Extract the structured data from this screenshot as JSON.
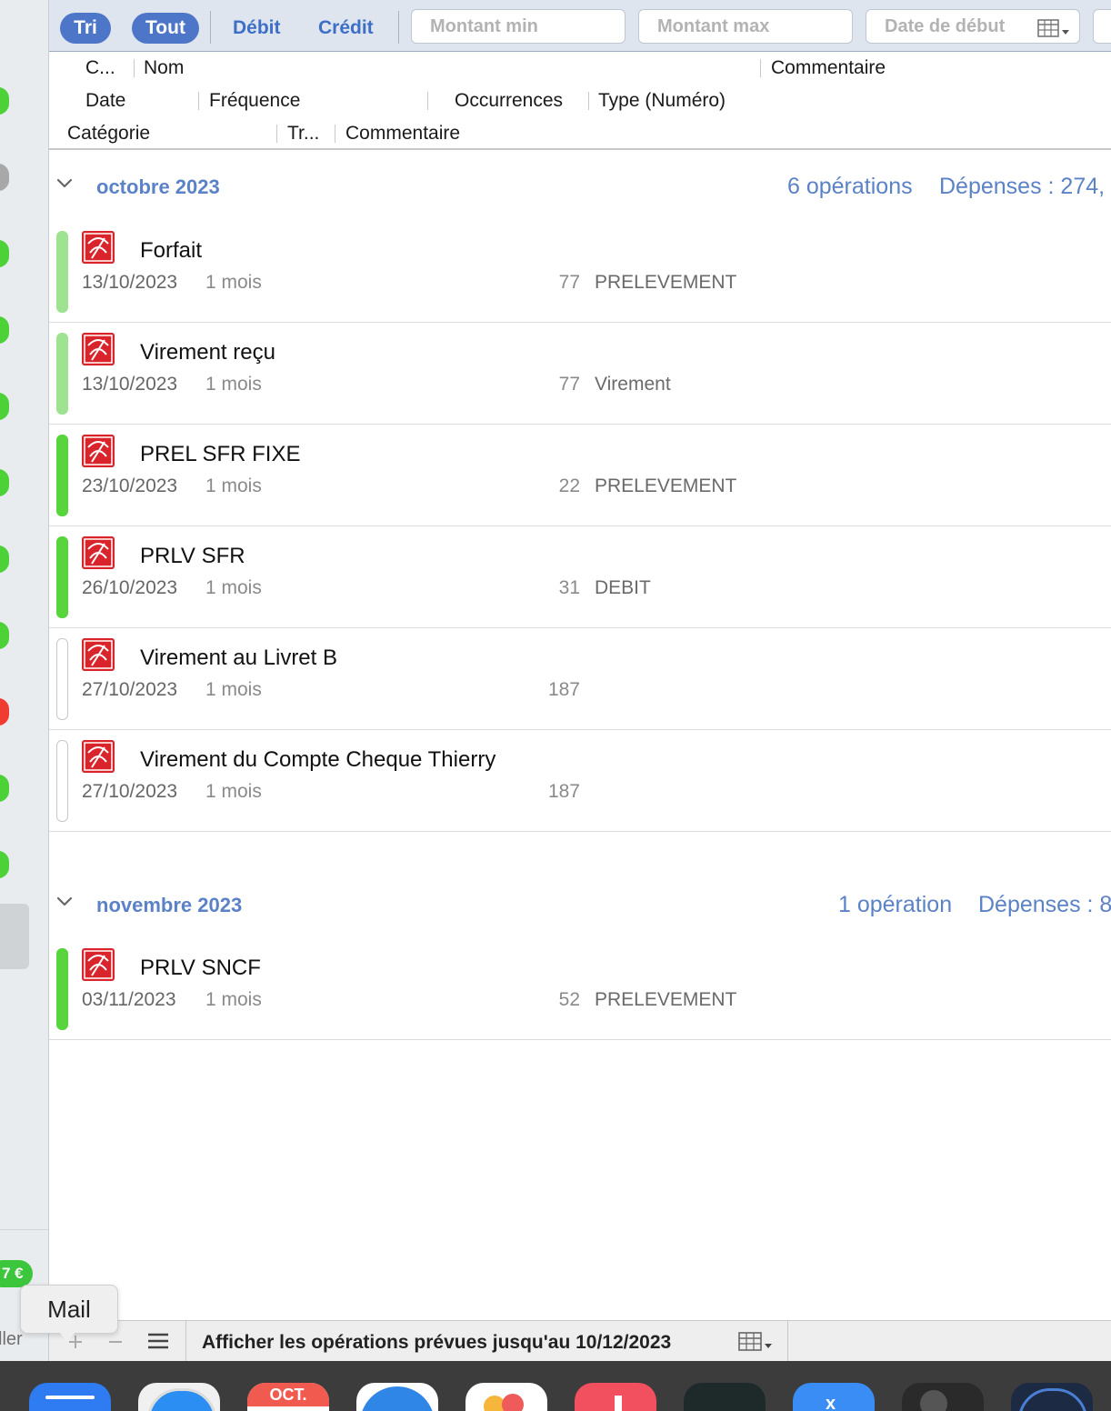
{
  "toolbar": {
    "sort_label": "Tri",
    "all_label": "Tout",
    "debit_label": "Débit",
    "credit_label": "Crédit",
    "amount_min_placeholder": "Montant min",
    "amount_max_placeholder": "Montant max",
    "start_date_placeholder": "Date de début",
    "calendar_icon": "calendar-grid-icon"
  },
  "columns": {
    "c": "C...",
    "nom": "Nom",
    "commentaire_top": "Commentaire",
    "date": "Date",
    "frequence": "Fréquence",
    "occurrences": "Occurrences",
    "type_numero": "Type (Numéro)",
    "categorie": "Catégorie",
    "tr": "Tr...",
    "commentaire_bottom": "Commentaire"
  },
  "groups": [
    {
      "month": "octobre 2023",
      "count": "6 opérations",
      "expenses": "Dépenses : 274,",
      "rows": [
        {
          "name": "Forfait",
          "date": "13/10/2023",
          "frequency": "1 mois",
          "occurrences": "77",
          "type": "PRELEVEMENT",
          "status": "lightgreen"
        },
        {
          "name": "Virement reçu",
          "date": "13/10/2023",
          "frequency": "1 mois",
          "occurrences": "77",
          "type": "Virement",
          "status": "lightgreen"
        },
        {
          "name": "PREL SFR FIXE",
          "date": "23/10/2023",
          "frequency": "1 mois",
          "occurrences": "22",
          "type": "PRELEVEMENT",
          "status": "green"
        },
        {
          "name": "PRLV SFR",
          "date": "26/10/2023",
          "frequency": "1 mois",
          "occurrences": "31",
          "type": "DEBIT",
          "status": "green"
        },
        {
          "name": "Virement au Livret B",
          "date": "27/10/2023",
          "frequency": "1 mois",
          "occurrences": "187",
          "type": "",
          "status": "empty"
        },
        {
          "name": "Virement du Compte Cheque Thierry",
          "date": "27/10/2023",
          "frequency": "1 mois",
          "occurrences": "187",
          "type": "",
          "status": "empty"
        }
      ]
    },
    {
      "month": "novembre 2023",
      "count": "1 opération",
      "expenses": "Dépenses : 8",
      "rows": [
        {
          "name": "PRLV SNCF",
          "date": "03/11/2023",
          "frequency": "1 mois",
          "occurrences": "52",
          "type": "PRELEVEMENT",
          "status": "green"
        }
      ]
    }
  ],
  "bottom": {
    "display_text": "Afficher les opérations prévues jusqu'au 10/12/2023",
    "add_icon": "plus-icon",
    "remove_icon": "minus-icon",
    "menu_icon": "hamburger-icon"
  },
  "sidebar": {
    "balance_label": "7 €",
    "bottom_label": "ller"
  },
  "tooltip": {
    "label": "Mail"
  },
  "dock": {
    "calendar_month": "OCT.",
    "apps": [
      "mail-app-icon",
      "safari-app-icon",
      "calendar-app-icon",
      "bank-app-icon",
      "photos-app-icon",
      "music-app-icon",
      "terminal-app-icon",
      "xcode-app-icon",
      "script-app-icon",
      "compass-app-icon"
    ]
  },
  "colors": {
    "accent": "#4e76c8",
    "month_text": "#5b82c6",
    "status_green": "#58d43c",
    "status_lightgreen": "#9ee38f",
    "logo_red": "#d9242b"
  }
}
